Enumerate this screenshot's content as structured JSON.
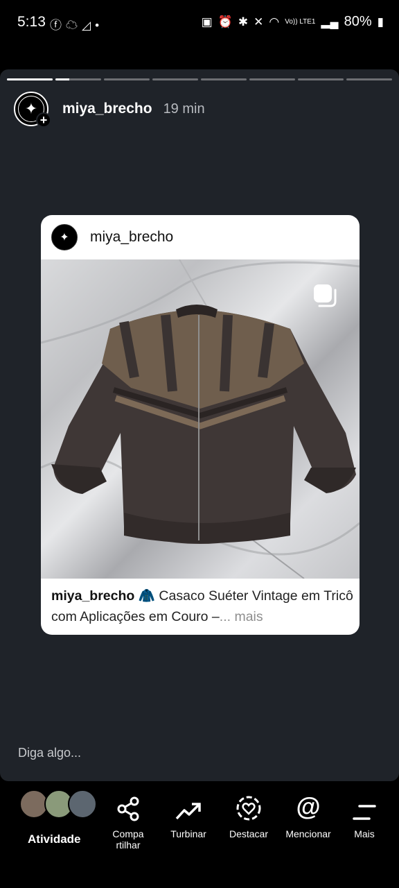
{
  "status_bar": {
    "time": "5:13",
    "left_icons": [
      "facebook-icon",
      "cloud-icon",
      "signal-question-icon",
      "dot-icon"
    ],
    "right_icons": [
      "alarm-box-icon",
      "alarm-icon",
      "bluetooth-icon",
      "mute-icon",
      "wifi-icon",
      "volte-icon",
      "signal-icon"
    ],
    "volte_text": "Vo)) LTE1",
    "battery": "80%"
  },
  "story": {
    "progress_total": 8,
    "progress_current_index": 1,
    "progress_current_fraction": 0.3,
    "username": "miya_brecho",
    "time_ago": "19 min",
    "reply_placeholder": "Diga algo..."
  },
  "post_card": {
    "username": "miya_brecho",
    "caption_user": "miya_brecho",
    "caption_emoji": "🧥",
    "caption_text": " Casaco Suéter Vintage em Tricô com Aplicações em Couro –",
    "ellipsis": "...",
    "more_label": " mais",
    "image_icon": "multiple-images-icon"
  },
  "bottom_bar": {
    "activity_label": "Atividade",
    "share_label_line1": "Compa",
    "share_label_line2": "rtilhar",
    "boost_label": "Turbinar",
    "highlight_label": "Destacar",
    "mention_label": "Mencionar",
    "more_label": "Mais"
  },
  "colors": {
    "story_bg": "#1f2329",
    "bar_bg": "#000000",
    "card_bg": "#ffffff"
  }
}
